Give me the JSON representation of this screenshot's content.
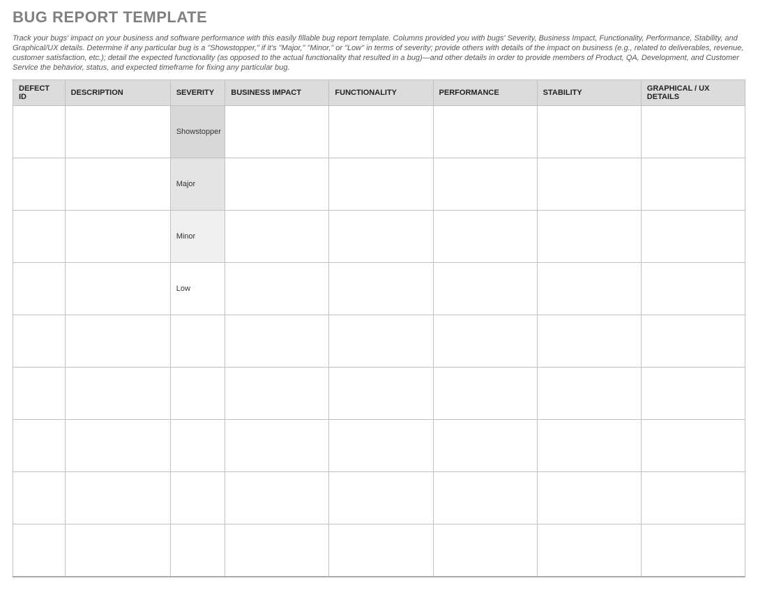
{
  "title": "BUG REPORT TEMPLATE",
  "intro": "Track your bugs' impact on your business and software performance with this easily fillable bug report template. Columns provided you with bugs' Severity, Business Impact, Functionality, Performance, Stability, and Graphical/UX details. Determine if any particular bug is a \"Showstopper,\" if it's \"Major,\" \"Minor,\" or \"Low\" in terms of severity; provide others with details of the impact on business (e.g., related to deliverables, revenue, customer satisfaction, etc.); detail the expected functionality (as opposed to the actual functionality that resulted in a bug)—and other details in order to provide members of Product, QA, Development, and Customer Service the behavior, status, and expected timeframe for fixing any particular bug.",
  "columns": {
    "defect_id": "DEFECT ID",
    "description": "DESCRIPTION",
    "severity": "SEVERITY",
    "business_impact": "BUSINESS IMPACT",
    "functionality": "FUNCTIONALITY",
    "performance": "PERFORMANCE",
    "stability": "STABILITY",
    "graphical_ux": "GRAPHICAL / UX DETAILS"
  },
  "rows": [
    {
      "defect_id": "",
      "description": "",
      "severity": "Showstopper",
      "sev_level": 1,
      "business_impact": "",
      "functionality": "",
      "performance": "",
      "stability": "",
      "graphical_ux": ""
    },
    {
      "defect_id": "",
      "description": "",
      "severity": "Major",
      "sev_level": 2,
      "business_impact": "",
      "functionality": "",
      "performance": "",
      "stability": "",
      "graphical_ux": ""
    },
    {
      "defect_id": "",
      "description": "",
      "severity": "Minor",
      "sev_level": 3,
      "business_impact": "",
      "functionality": "",
      "performance": "",
      "stability": "",
      "graphical_ux": ""
    },
    {
      "defect_id": "",
      "description": "",
      "severity": "Low",
      "sev_level": 4,
      "business_impact": "",
      "functionality": "",
      "performance": "",
      "stability": "",
      "graphical_ux": ""
    },
    {
      "defect_id": "",
      "description": "",
      "severity": "",
      "sev_level": 0,
      "business_impact": "",
      "functionality": "",
      "performance": "",
      "stability": "",
      "graphical_ux": ""
    },
    {
      "defect_id": "",
      "description": "",
      "severity": "",
      "sev_level": 0,
      "business_impact": "",
      "functionality": "",
      "performance": "",
      "stability": "",
      "graphical_ux": ""
    },
    {
      "defect_id": "",
      "description": "",
      "severity": "",
      "sev_level": 0,
      "business_impact": "",
      "functionality": "",
      "performance": "",
      "stability": "",
      "graphical_ux": ""
    },
    {
      "defect_id": "",
      "description": "",
      "severity": "",
      "sev_level": 0,
      "business_impact": "",
      "functionality": "",
      "performance": "",
      "stability": "",
      "graphical_ux": ""
    },
    {
      "defect_id": "",
      "description": "",
      "severity": "",
      "sev_level": 0,
      "business_impact": "",
      "functionality": "",
      "performance": "",
      "stability": "",
      "graphical_ux": ""
    }
  ]
}
